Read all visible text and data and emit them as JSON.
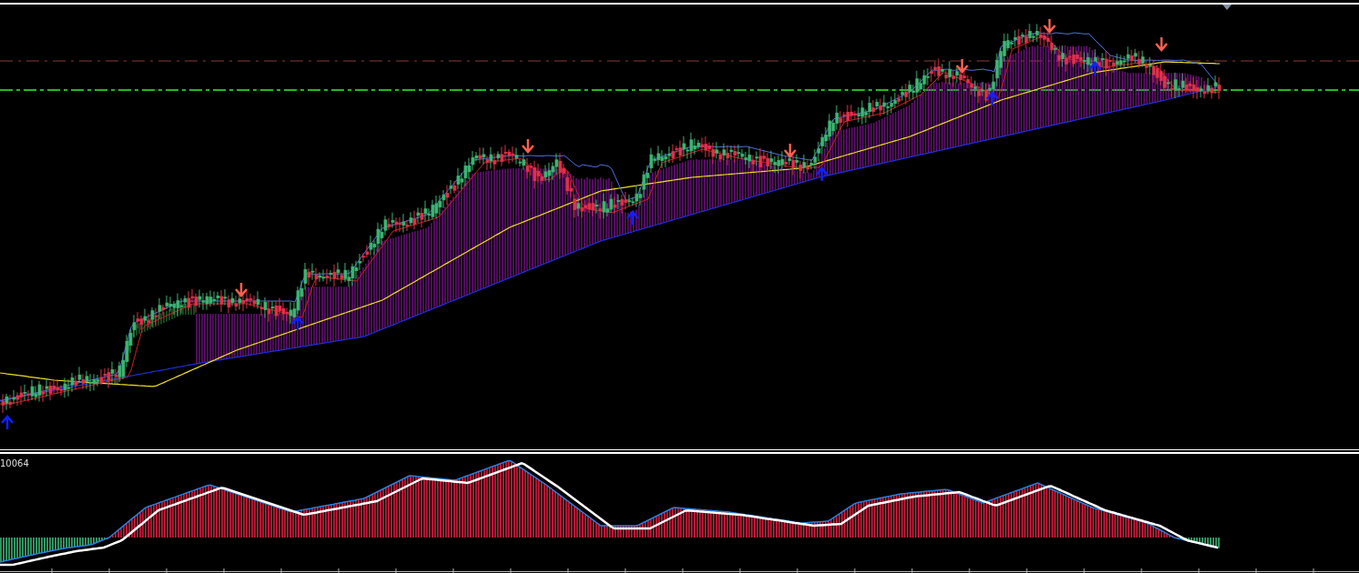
{
  "indicator_panel": {
    "value_label": "10064"
  }
}
